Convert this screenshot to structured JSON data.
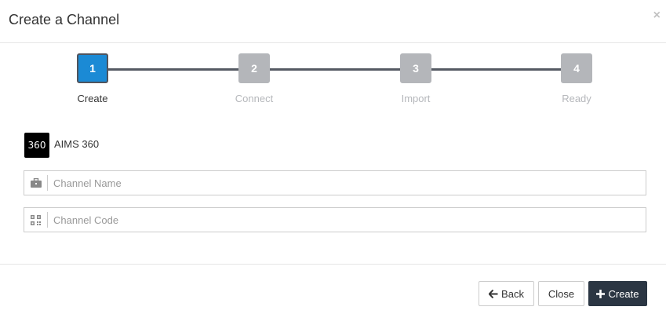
{
  "modal": {
    "title": "Create a Channel",
    "close_symbol": "×"
  },
  "stepper": {
    "steps": [
      {
        "number": "1",
        "label": "Create",
        "state": "active"
      },
      {
        "number": "2",
        "label": "Connect",
        "state": "inactive"
      },
      {
        "number": "3",
        "label": "Import",
        "state": "inactive"
      },
      {
        "number": "4",
        "label": "Ready",
        "state": "inactive"
      }
    ]
  },
  "brand": {
    "logo_text": "360",
    "name": "AIMS 360"
  },
  "form": {
    "channel_name": {
      "value": "",
      "placeholder": "Channel Name",
      "icon": "briefcase-icon"
    },
    "channel_code": {
      "value": "",
      "placeholder": "Channel Code",
      "icon": "qrcode-icon"
    }
  },
  "footer": {
    "back_label": "Back",
    "close_label": "Close",
    "create_label": "Create"
  },
  "colors": {
    "active_step": "#1b8ad5",
    "inactive_step": "#b4b6ba",
    "connector": "#555a63",
    "primary_button": "#2b3643"
  }
}
